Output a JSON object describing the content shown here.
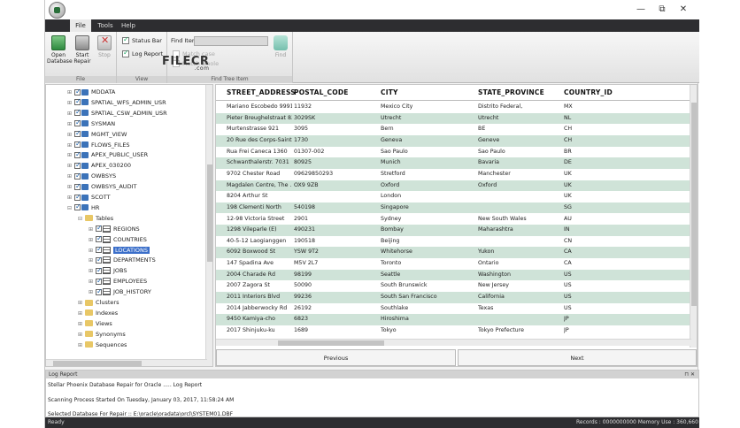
{
  "window": {
    "minimize": "—",
    "restore": "⧉",
    "close": "✕"
  },
  "menu": {
    "tabs": [
      "File",
      "Tools",
      "Help"
    ],
    "active": "File"
  },
  "ribbon": {
    "file_group": {
      "label": "File",
      "open_database": "Open Database",
      "start_repair": "Start Repair",
      "stop": "Stop"
    },
    "view_group": {
      "label": "View",
      "status_bar": "Status Bar",
      "log_report": "Log Report"
    },
    "find_group": {
      "label": "Find Tree Item",
      "find_item": "Find Item",
      "match_case": "Match case",
      "match_whole": "Match whole",
      "find": "Find",
      "find_value": ""
    }
  },
  "watermark": {
    "text": "FILECR",
    "sub": ".com"
  },
  "tree": {
    "items": [
      {
        "label": "MDDATA",
        "icon": "database-icon",
        "level": 0
      },
      {
        "label": "SPATIAL_WFS_ADMIN_USR",
        "icon": "database-icon",
        "level": 0
      },
      {
        "label": "SPATIAL_CSW_ADMIN_USR",
        "icon": "database-icon",
        "level": 0
      },
      {
        "label": "SYSMAN",
        "icon": "database-icon",
        "level": 0
      },
      {
        "label": "MGMT_VIEW",
        "icon": "database-icon",
        "level": 0
      },
      {
        "label": "FLOWS_FILES",
        "icon": "database-icon",
        "level": 0
      },
      {
        "label": "APEX_PUBLIC_USER",
        "icon": "database-icon",
        "level": 0
      },
      {
        "label": "APEX_030200",
        "icon": "database-icon",
        "level": 0
      },
      {
        "label": "OWBSYS",
        "icon": "database-icon",
        "level": 0
      },
      {
        "label": "OWBSYS_AUDIT",
        "icon": "database-icon",
        "level": 0
      },
      {
        "label": "SCOTT",
        "icon": "database-icon",
        "level": 0
      },
      {
        "label": "HR",
        "icon": "database-icon",
        "level": 0
      },
      {
        "label": "Tables",
        "icon": "folder-icon",
        "level": 1
      },
      {
        "label": "REGIONS",
        "icon": "table-icon",
        "level": 2
      },
      {
        "label": "COUNTRIES",
        "icon": "table-icon",
        "level": 2
      },
      {
        "label": "LOCATIONS",
        "icon": "table-icon",
        "level": 2,
        "selected": true
      },
      {
        "label": "DEPARTMENTS",
        "icon": "table-icon",
        "level": 2
      },
      {
        "label": "JOBS",
        "icon": "table-icon",
        "level": 2
      },
      {
        "label": "EMPLOYEES",
        "icon": "table-icon",
        "level": 2
      },
      {
        "label": "JOB_HISTORY",
        "icon": "table-icon",
        "level": 2
      },
      {
        "label": "Clusters",
        "icon": "folder-icon",
        "level": 1
      },
      {
        "label": "Indexes",
        "icon": "folder-icon",
        "level": 1
      },
      {
        "label": "Views",
        "icon": "folder-icon",
        "level": 1
      },
      {
        "label": "Synonyms",
        "icon": "folder-icon",
        "level": 1
      },
      {
        "label": "Sequences",
        "icon": "folder-icon",
        "level": 1
      }
    ]
  },
  "grid": {
    "columns": [
      "STREET_ADDRESS",
      "POSTAL_CODE",
      "CITY",
      "STATE_PROVINCE",
      "COUNTRY_ID"
    ],
    "rows": [
      [
        "Mariano Escobedo 9991",
        "11932",
        "Mexico City",
        "Distrito Federal,",
        "MX"
      ],
      [
        "Pieter Breughelstraat 837",
        "3029SK",
        "Utrecht",
        "Utrecht",
        "NL"
      ],
      [
        "Murtenstrasse 921",
        "3095",
        "Bern",
        "BE",
        "CH"
      ],
      [
        "20 Rue des Corps-Saints",
        "1730",
        "Geneva",
        "Geneve",
        "CH"
      ],
      [
        "Rua Frei Caneca 1360",
        "01307-002",
        "Sao Paulo",
        "Sao Paulo",
        "BR"
      ],
      [
        "Schwanthalerstr. 7031",
        "80925",
        "Munich",
        "Bavaria",
        "DE"
      ],
      [
        "9702 Chester Road",
        "09629850293",
        "Stretford",
        "Manchester",
        "UK"
      ],
      [
        "Magdalen Centre, The ...",
        "OX9 9ZB",
        "Oxford",
        "Oxford",
        "UK"
      ],
      [
        "8204 Arthur St",
        "",
        "London",
        "",
        "UK"
      ],
      [
        "198 Clementi North",
        "540198",
        "Singapore",
        "",
        "SG"
      ],
      [
        "12-98 Victoria Street",
        "2901",
        "Sydney",
        "New South Wales",
        "AU"
      ],
      [
        "1298 Vileparle (E)",
        "490231",
        "Bombay",
        "Maharashtra",
        "IN"
      ],
      [
        "40-5-12 Laogianggen",
        "190518",
        "Beijing",
        "",
        "CN"
      ],
      [
        "6092 Boxwood St",
        "YSW 9T2",
        "Whitehorse",
        "Yukon",
        "CA"
      ],
      [
        "147 Spadina Ave",
        "M5V 2L7",
        "Toronto",
        "Ontario",
        "CA"
      ],
      [
        "2004 Charade Rd",
        "98199",
        "Seattle",
        "Washington",
        "US"
      ],
      [
        "2007 Zagora St",
        "50090",
        "South Brunswick",
        "New Jersey",
        "US"
      ],
      [
        "2011 Interiors Blvd",
        "99236",
        "South San Francisco",
        "California",
        "US"
      ],
      [
        "2014 Jabberwocky Rd",
        "26192",
        "Southlake",
        "Texas",
        "US"
      ],
      [
        "9450 Kamiya-cho",
        "6823",
        "Hiroshima",
        "",
        "JP"
      ],
      [
        "2017 Shinjuku-ku",
        "1689",
        "Tokyo",
        "Tokyo Prefecture",
        "JP"
      ]
    ],
    "previous": "Previous",
    "next": "Next"
  },
  "log": {
    "title": "Log Report",
    "pin": "⊓ ✕",
    "lines": [
      "Stellar Phoenix Database Repair for Oracle ..... Log Report",
      "Scanning Process Started On Tuesday, January 03, 2017, 11:58:24 AM",
      "Selected Database For Repair :: E:\\oracle\\oradata\\orcl\\SYSTEM01.DBF"
    ]
  },
  "status": {
    "left": "Ready",
    "right": "Records : 0000000000  Memory Use : 360,660 KB"
  }
}
